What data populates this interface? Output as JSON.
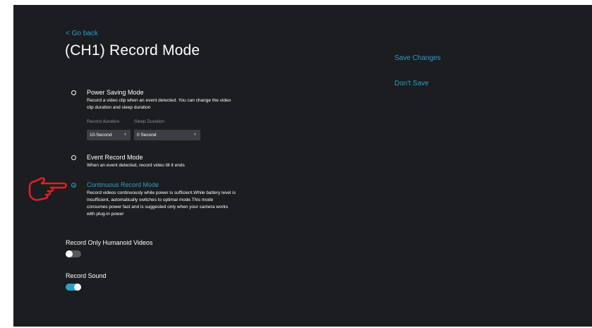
{
  "nav": {
    "back_label": "< Go back"
  },
  "page": {
    "title": "(CH1)  Record Mode"
  },
  "actions": {
    "save_label": "Save Changes",
    "dont_save_label": "Don't Save"
  },
  "modes": [
    {
      "title": "Power Saving Mode",
      "desc_lines": [
        "Record a video clip when an event detected. You can change the video",
        "clip duration and sleep duration"
      ],
      "selected": false
    },
    {
      "title": "Event Record Mode",
      "desc_lines": [
        "When an event detected, record video till it ends"
      ],
      "selected": false
    },
    {
      "title": "Continuous Record Mode",
      "desc_lines": [
        "Record videos continuously while power is sufficient.While battery level is",
        "insufficient, automatically switches to optimal mode.This mode",
        "consumes power fast and is suggested only when your camera works",
        "with plug-in power"
      ],
      "selected": true
    }
  ],
  "power_saving_fields": {
    "record_duration_label": "Record duration",
    "record_duration_value": "10-Second",
    "sleep_duration_label": "Sleep Duration",
    "sleep_duration_value": "0 Second"
  },
  "toggles": {
    "humanoid": {
      "label": "Record Only Humanoid Videos",
      "on": false
    },
    "sound": {
      "label": "Record Sound",
      "on": true
    }
  },
  "colors": {
    "accent": "#2ea0c4",
    "background": "#1b1d20",
    "pointer_hand": "#e02020"
  },
  "icons": {
    "pointer": "pointing-hand-icon",
    "caret": "caret-down-icon"
  }
}
